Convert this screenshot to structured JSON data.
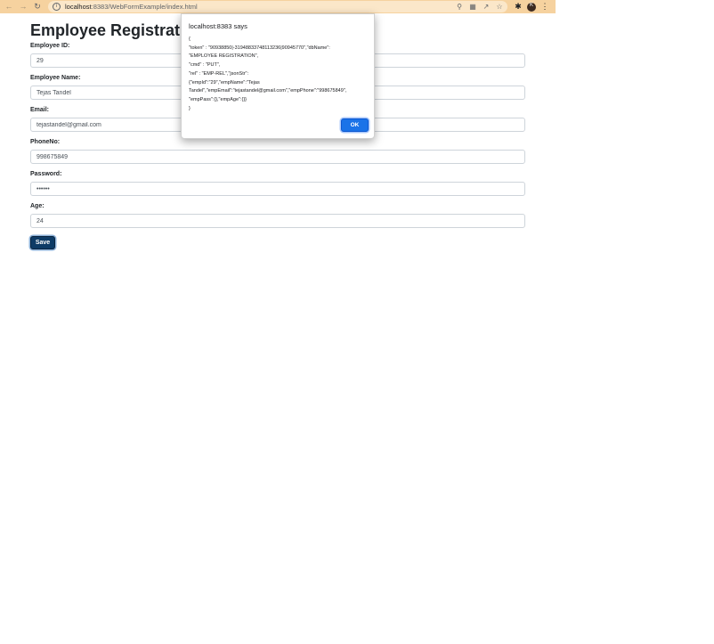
{
  "browser": {
    "url_host": "localhost",
    "url_path": ":8383/WebFormExample/index.html",
    "back_icon": "arrow-left-icon",
    "forward_icon": "arrow-right-icon",
    "reload_icon": "reload-icon",
    "avatar_initial": "K"
  },
  "page": {
    "title": "Employee Registration F",
    "fields": [
      {
        "label": "Employee ID:",
        "value": "29"
      },
      {
        "label": "Employee Name:",
        "value": "Tejas Tandel"
      },
      {
        "label": "Email:",
        "value": "tejastandel@gmail.com"
      },
      {
        "label": "PhoneNo:",
        "value": "998675849"
      },
      {
        "label": "Password:",
        "value": "••••••"
      },
      {
        "label": "Age:",
        "value": "24"
      }
    ],
    "save_label": "Save"
  },
  "dialog": {
    "title": "localhost:8383 says",
    "message": "{\n\"token\" : \"90938850|-31948833748113236|90945770\",\"dbName\":\n\"EMPLOYEE REGISTRATION\",\n\"cmd\" : \"PUT\",\n\"rel\" : \"EMP-REL\",\"jsonStr\":\n{\"empId\":\"29\",\"empName\":\"Tejas\nTandel\",\"empEmail\":\"tejastandel@gmail.com\",\"empPhone\":\"998675849\",\n\"empPass\":{},\"empAge\":{}}\n}",
    "ok_label": "OK"
  },
  "colors": {
    "chrome_bar": "#f6d29f",
    "save_button": "#0d3b66",
    "ok_button": "#1a73e8"
  }
}
